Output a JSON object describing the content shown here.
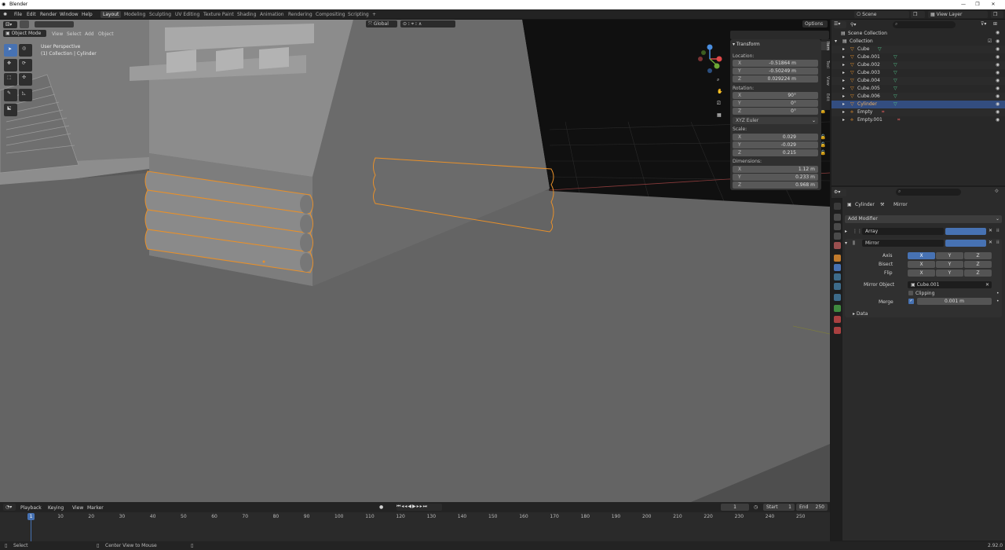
{
  "window": {
    "title": "Blender"
  },
  "menus": [
    "File",
    "Edit",
    "Render",
    "Window",
    "Help"
  ],
  "workspaces": [
    "Layout",
    "Modeling",
    "Sculpting",
    "UV Editing",
    "Texture Paint",
    "Shading",
    "Animation",
    "Rendering",
    "Compositing",
    "Scripting"
  ],
  "workspace_add": "+",
  "scene": {
    "name": "Scene",
    "view_layer": "View Layer"
  },
  "viewport": {
    "mode": "Object Mode",
    "menus": [
      "View",
      "Select",
      "Add",
      "Object"
    ],
    "transform_orientation": "Global",
    "options": "Options",
    "info_line1": "User Perspective",
    "info_line2": "(1) Collection | Cylinder"
  },
  "npanel": {
    "header": "Transform",
    "location_label": "Location:",
    "location": [
      {
        "axis": "X",
        "value": "-0.51864 m"
      },
      {
        "axis": "Y",
        "value": "-0.50249 m"
      },
      {
        "axis": "Z",
        "value": "0.029224 m"
      }
    ],
    "rotation_label": "Rotation:",
    "rotation": [
      {
        "axis": "X",
        "value": "90°"
      },
      {
        "axis": "Y",
        "value": "0°"
      },
      {
        "axis": "Z",
        "value": "0°"
      }
    ],
    "rotation_mode": "XYZ Euler",
    "scale_label": "Scale:",
    "scale": [
      {
        "axis": "X",
        "value": "0.029"
      },
      {
        "axis": "Y",
        "value": "-0.029"
      },
      {
        "axis": "Z",
        "value": "0.215"
      }
    ],
    "dimensions_label": "Dimensions:",
    "dimensions": [
      {
        "axis": "X",
        "value": "1.12 m"
      },
      {
        "axis": "Y",
        "value": "0.233 m"
      },
      {
        "axis": "Z",
        "value": "0.968 m"
      }
    ],
    "tabs": [
      "Item",
      "Tool",
      "View",
      "Edit"
    ]
  },
  "outliner": {
    "root": "Scene Collection",
    "items": [
      {
        "name": "Collection",
        "indent": 1
      },
      {
        "name": "Cube",
        "indent": 2
      },
      {
        "name": "Cube.001",
        "indent": 2
      },
      {
        "name": "Cube.002",
        "indent": 2
      },
      {
        "name": "Cube.003",
        "indent": 2
      },
      {
        "name": "Cube.004",
        "indent": 2
      },
      {
        "name": "Cube.005",
        "indent": 2
      },
      {
        "name": "Cube.006",
        "indent": 2
      },
      {
        "name": "Cylinder",
        "indent": 2,
        "selected": true
      },
      {
        "name": "Empty",
        "indent": 2
      },
      {
        "name": "Empty.001",
        "indent": 2
      }
    ]
  },
  "properties": {
    "object": "Cylinder",
    "modifier_name": "Mirror",
    "add_modifier": "Add Modifier",
    "modifiers": [
      {
        "name": "Array"
      },
      {
        "name": "Mirror"
      }
    ],
    "axis_label": "Axis",
    "bisect_label": "Bisect",
    "flip_label": "Flip",
    "axes": [
      "X",
      "Y",
      "Z"
    ],
    "mirror_object_label": "Mirror Object",
    "mirror_object": "Cube.001",
    "clipping_label": "Clipping",
    "merge_label": "Merge",
    "merge_value": "0.001 m",
    "data_label": "Data"
  },
  "timeline": {
    "menus": [
      "Playback",
      "Keying",
      "View",
      "Marker"
    ],
    "current_frame": "1",
    "start_label": "Start",
    "start": "1",
    "end_label": "End",
    "end": "250",
    "ticks": [
      "10",
      "20",
      "30",
      "40",
      "50",
      "60",
      "70",
      "80",
      "90",
      "100",
      "110",
      "120",
      "130",
      "140",
      "150",
      "160",
      "170",
      "180",
      "190",
      "200",
      "210",
      "220",
      "230",
      "240",
      "250"
    ],
    "playhead": "1"
  },
  "status": {
    "select": "Select",
    "center_view": "Center View to Mouse",
    "version": "2.92.0"
  },
  "colors": {
    "accent": "#4772b3",
    "selection_outline": "#e8902a",
    "header": "#232323"
  }
}
